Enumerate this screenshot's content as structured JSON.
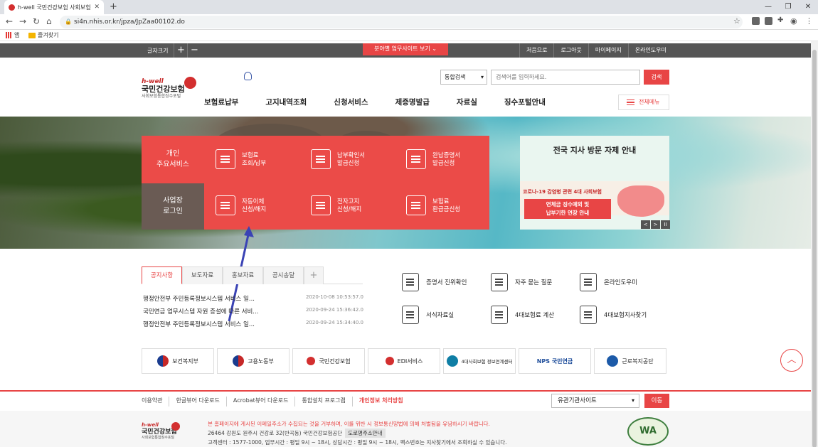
{
  "browser": {
    "tab_title": "h-well 국민건강보험 사회보험통",
    "url": "si4n.nhis.or.kr/jpza/JpZaa00102.do",
    "bookmarks": [
      "앱",
      "즐겨찾기"
    ]
  },
  "util": {
    "fontsize_label": "글자크기",
    "plus": "+",
    "minus": "−",
    "site_button": "분야별 업무사이트 보기 ⌄",
    "links": [
      "처음으로",
      "로그아웃",
      "마이페이지",
      "온라인도우미"
    ]
  },
  "header": {
    "logo_hwell": "h-well",
    "logo_main": "국민건강보험",
    "logo_sub": "사회보험통합징수포털",
    "search_select": "통합검색",
    "search_placeholder": "검색어를 입력하세요.",
    "search_button": "검색",
    "gnb": [
      "보험료납부",
      "고지내역조회",
      "신청서비스",
      "제증명발급",
      "자료실",
      "징수포털안내"
    ],
    "all_menu": "전체메뉴"
  },
  "hero": {
    "tab_personal": [
      "개인",
      "주요서비스"
    ],
    "tab_biz": [
      "사업장",
      "로그인"
    ],
    "services": [
      {
        "line1": "보험료",
        "line2": "조회/납부"
      },
      {
        "line1": "납부확인서",
        "line2": "발급신청"
      },
      {
        "line1": "완납증명서",
        "line2": "발급신청"
      },
      {
        "line1": "자동이체",
        "line2": "신청/해지"
      },
      {
        "line1": "전자고지",
        "line2": "신청/해지"
      },
      {
        "line1": "보험료",
        "line2": "환급금신청"
      }
    ],
    "banner": {
      "title": "전국 지사 방문 자제 안내",
      "red_text": "코로나-19 감염병 관련 4대 사회보험",
      "box_line1": "연체금 징수예외 및",
      "box_line2": "납부기한 연장 안내",
      "controls": [
        "<",
        ">",
        "II"
      ]
    }
  },
  "notice": {
    "tabs": [
      "공지사항",
      "보도자료",
      "홍보자료",
      "공시송달",
      "+"
    ],
    "items": [
      {
        "title": "행정안전부 주민등록정보시스템 서비스 일...",
        "date": "2020-10-08 10:53:57.0"
      },
      {
        "title": "국민연금 업무시스템 자원 증설에 따른 서비...",
        "date": "2020-09-24 15:36:42.0"
      },
      {
        "title": "행정안전부 주민등록정보시스템 서비스 일...",
        "date": "2020-09-24 15:34:40.0"
      }
    ]
  },
  "quick": [
    {
      "label": "증명서 진위확인",
      "icon": "certificate-icon"
    },
    {
      "label": "자주 묻는 질문",
      "icon": "chat-icon"
    },
    {
      "label": "온라인도우미",
      "icon": "headset-icon"
    },
    {
      "label": "서식자료실",
      "icon": "document-icon"
    },
    {
      "label": "4대보험료 계산",
      "icon": "calculator-icon"
    },
    {
      "label": "4대보험지사찾기",
      "icon": "map-pin-icon"
    }
  ],
  "partners": [
    "보건복지부",
    "고용노동부",
    "국민건강보험",
    "EDI서비스",
    "4대사회보험 정보연계센터",
    "NPS 국민연금",
    "근로복지공단"
  ],
  "footer": {
    "links": [
      "이용약관",
      "한글뷰어 다운로드",
      "Acrobat뷰어 다운로드",
      "통합설치 프로그램",
      "개인정보 처리방침"
    ],
    "related_site": "유관기관사이트",
    "go_button": "이동",
    "warn": "본 홈페이지에 게시된 이메일주소가 수집되는 것을 거부하며, 이를 위반 시 정보통신망법에 의해 처벌됨을 유념하시기 바랍니다.",
    "address": "26464 강원도 원주시 건강로 32(반곡동) 국민건강보험공단",
    "address_button": "도로명주소안내",
    "contact": "고객센터 : 1577-1000, 업무시간 : 평일 9시 ~ 18시, 상담시간 : 평일 9시 ~ 18시, 팩스번호는 지사찾기에서 조회하실 수 있습니다.",
    "wa": "WA"
  },
  "colors": {
    "accent": "#e84545",
    "dark_bar": "#555555",
    "biz_tab": "#6a5b54"
  }
}
